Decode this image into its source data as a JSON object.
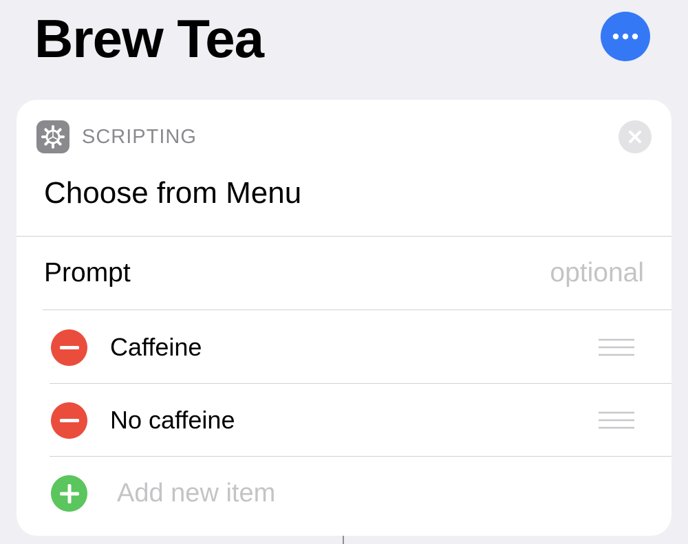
{
  "header": {
    "title": "Brew Tea",
    "more_icon": "ellipsis-icon",
    "accent_color": "#3478f6"
  },
  "action_card": {
    "category": "SCRIPTING",
    "category_icon": "gear-icon",
    "close_icon": "close-icon",
    "title": "Choose from Menu",
    "prompt": {
      "label": "Prompt",
      "value": "",
      "placeholder": "optional"
    },
    "menu_items": [
      {
        "label": "Caffeine"
      },
      {
        "label": "No caffeine"
      }
    ],
    "add_item_placeholder": "Add new item",
    "colors": {
      "remove": "#eb4d3d",
      "add": "#5bc55e"
    }
  }
}
